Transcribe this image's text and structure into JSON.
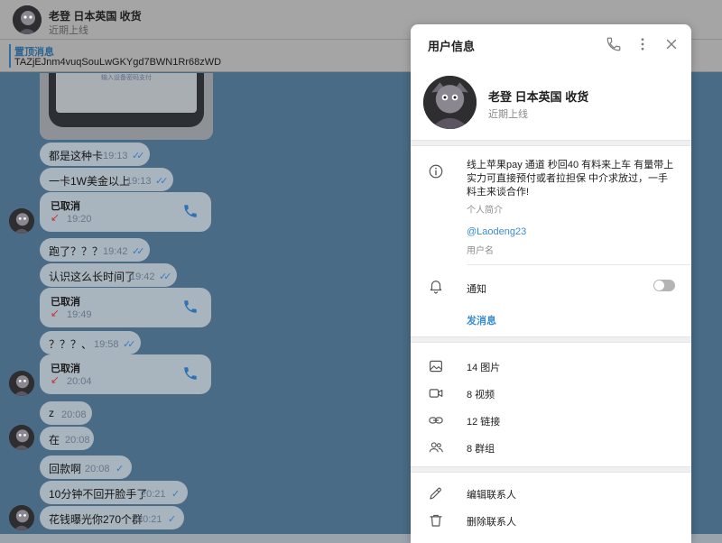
{
  "chat_header": {
    "name": "老登 日本英国 收货",
    "status": "近期上线"
  },
  "pinned": {
    "title": "置顶消息",
    "text": "TAZjEJnm4vuqSouLwGKYgd7BWN1Rr68zWD"
  },
  "image_message": {
    "caption": "输入设备密码支付"
  },
  "messages": [
    {
      "text": "都是这种卡",
      "time": "19:13",
      "check": "✓✓"
    },
    {
      "text": "一卡1W美金以上",
      "time": "19:13",
      "check": "✓✓"
    },
    {
      "text": "跑了？？？",
      "time": "19:42",
      "check": "✓✓"
    },
    {
      "text": "认识这么长时间了",
      "time": "19:42",
      "check": "✓✓"
    },
    {
      "text": "？？？、",
      "time": "19:58",
      "check": "✓✓"
    },
    {
      "text": "z",
      "time": "20:08"
    },
    {
      "text": "在",
      "time": "20:08"
    },
    {
      "text": "回款啊",
      "time": "20:08",
      "check": "✓"
    },
    {
      "text": "10分钟不回开脸手了",
      "time": "20:21",
      "check": "✓"
    },
    {
      "text": "花钱曝光你270个群",
      "time": "20:21",
      "check": "✓"
    }
  ],
  "calls": [
    {
      "title": "已取消",
      "arrow": "↙",
      "time": "19:20"
    },
    {
      "title": "已取消",
      "arrow": "↙",
      "time": "19:49"
    },
    {
      "title": "已取消",
      "arrow": "↙",
      "time": "20:04"
    }
  ],
  "panel": {
    "title": "用户信息",
    "name": "老登 日本英国 收货",
    "status": "近期上线",
    "bio": "线上苹果pay 通道 秒回40 有料来上车 有量带上实力可直接预付或者拉担保 中介求放过，一手料主来谈合作!",
    "bio_label": "个人简介",
    "username": "@Laodeng23",
    "username_label": "用户名",
    "notifications_label": "通知",
    "notifications_on": false,
    "send_message": "发消息",
    "media": [
      {
        "label": "14 图片",
        "icon": "image-icon"
      },
      {
        "label": "8 视频",
        "icon": "video-icon"
      },
      {
        "label": "12 链接",
        "icon": "link-icon"
      },
      {
        "label": "8 群组",
        "icon": "groups-icon"
      }
    ],
    "actions": [
      {
        "label": "编辑联系人",
        "icon": "edit-icon"
      },
      {
        "label": "删除联系人",
        "icon": "trash-icon"
      }
    ]
  },
  "colors": {
    "chat_bg": "#4a6b86",
    "bubble": "#a8b4be",
    "accent": "#3a8ccf",
    "missed_call": "#c13a35"
  }
}
